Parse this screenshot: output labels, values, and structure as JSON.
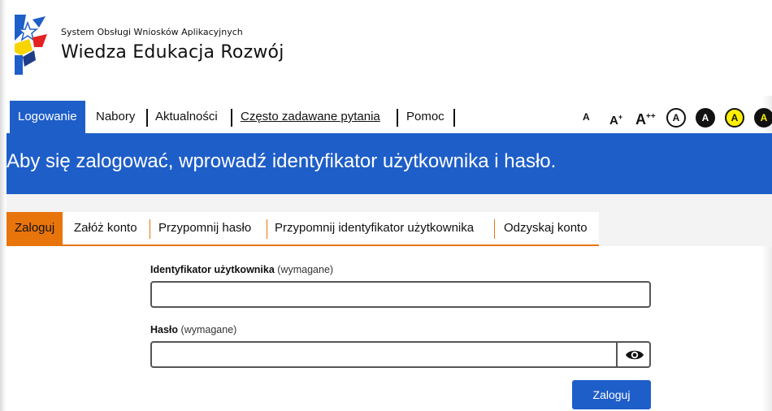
{
  "brand": {
    "subtitle": "System Obsługi Wniosków Aplikacyjnych",
    "title": "Wiedza Edukacja Rozwój"
  },
  "nav": {
    "items": [
      {
        "label": "Logowanie",
        "active": true
      },
      {
        "label": "Nabory"
      },
      {
        "label": "Aktualności"
      },
      {
        "label": "Często zadawane pytania"
      },
      {
        "label": "Pomoc"
      }
    ]
  },
  "accessibility": {
    "font_small": "A",
    "font_medium": "A",
    "font_medium_sup": "+",
    "font_large": "A",
    "font_large_sup": "++",
    "contrast_labels": [
      "A",
      "A",
      "A",
      "A"
    ],
    "colors": {
      "accent": "#1e5ec9",
      "yellow": "#ffef00",
      "orange": "#e8740c"
    }
  },
  "banner": {
    "text": "Aby się zalogować, wprowadź identyfikator użytkownika i hasło."
  },
  "subtabs": {
    "items": [
      {
        "label": "Zaloguj",
        "active": true
      },
      {
        "label": "Załóż konto"
      },
      {
        "label": "Przypomnij hasło"
      },
      {
        "label": "Przypomnij identyfikator użytkownika"
      },
      {
        "label": "Odzyskaj konto"
      }
    ]
  },
  "form": {
    "user_id_label": "Identyfikator użytkownika",
    "user_id_required": "(wymagane)",
    "user_id_value": "",
    "password_label": "Hasło",
    "password_required": "(wymagane)",
    "password_value": "",
    "show_password_icon": "eye-icon",
    "submit_label": "Zaloguj"
  }
}
